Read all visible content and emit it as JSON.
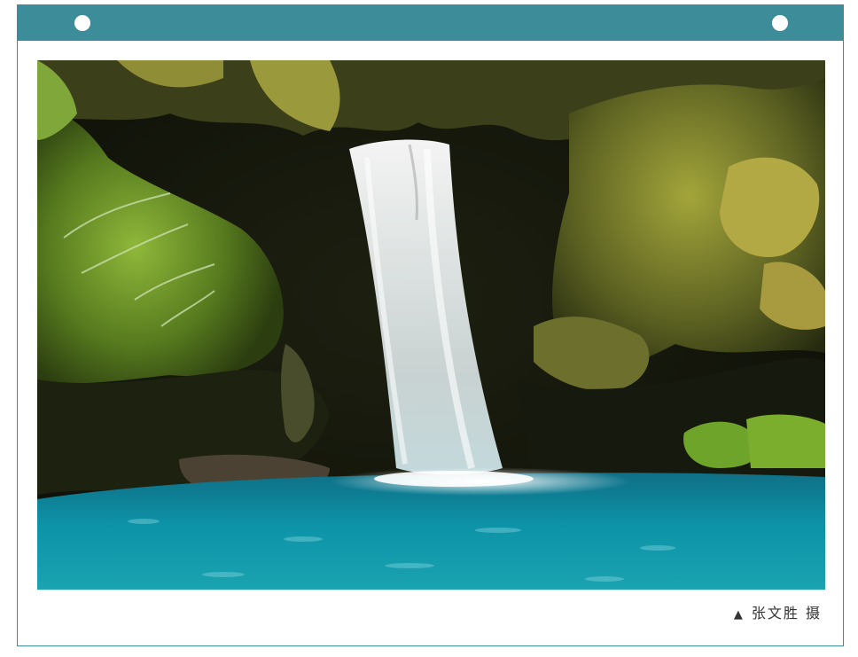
{
  "caption": {
    "marker": "▲",
    "credit": "张文胜 摄"
  },
  "colors": {
    "frame": "#3d8c9a",
    "background": "#ffffff",
    "caption_text": "#333333"
  },
  "photo": {
    "subject": "waterfall-in-mossy-cave-photo"
  }
}
